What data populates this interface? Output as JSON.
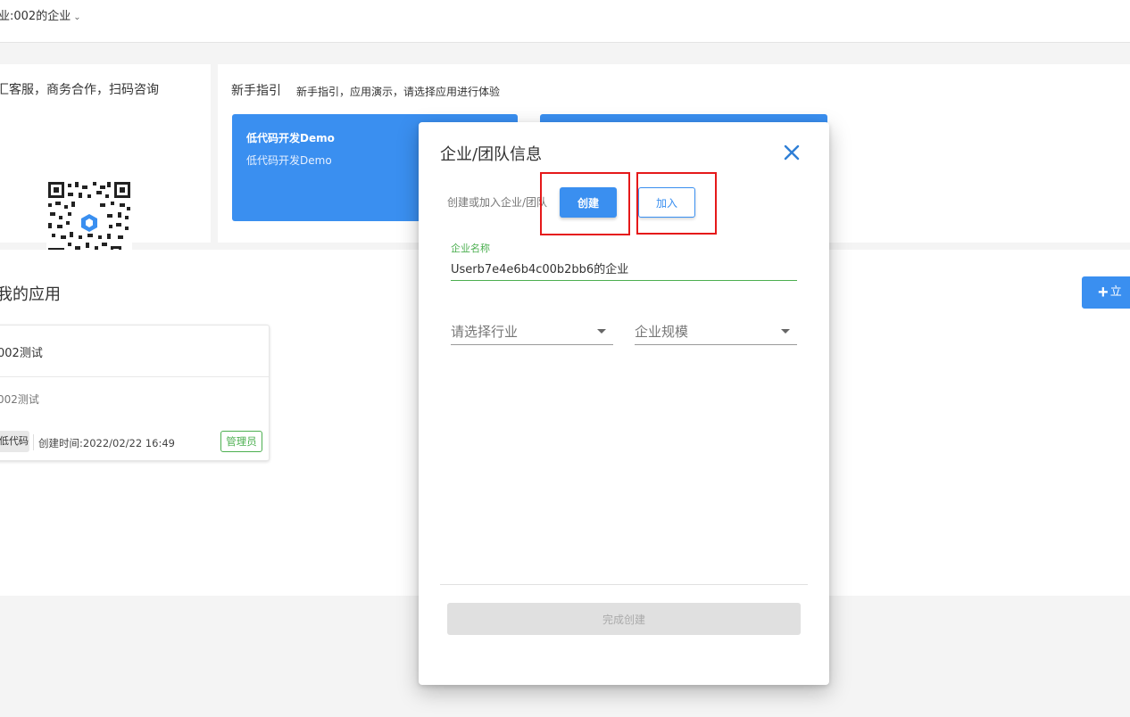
{
  "header": {
    "org_name": "业:002的企业"
  },
  "contact": {
    "title": "汇客服，商务合作，扫码咨询"
  },
  "guide": {
    "title": "新手指引",
    "subtitle": "新手指引，应用演示，请选择应用进行体验",
    "cards": [
      {
        "title": "低代码开发Demo",
        "desc": "低代码开发Demo"
      },
      {
        "title": "",
        "desc": ""
      }
    ]
  },
  "apps": {
    "heading": "我的应用",
    "add_label": "立",
    "items": [
      {
        "name": "002测试",
        "desc": "002测试",
        "tag": "低代码",
        "created": "创建时间:2022/02/22 16:49",
        "role": "管理员"
      }
    ]
  },
  "dialog": {
    "title": "企业/团队信息",
    "mode_label": "创建或加入企业/团队",
    "create_label": "创建",
    "join_label": "加入",
    "company_name_label": "企业名称",
    "company_name_value": "Userb7e4e6b4c00b2bb6的企业",
    "industry_placeholder": "请选择行业",
    "scale_placeholder": "企业规模",
    "finish_label": "完成创建"
  },
  "colors": {
    "primary": "#3a8ff0",
    "success": "#4caf50",
    "highlight": "#e5191a"
  }
}
